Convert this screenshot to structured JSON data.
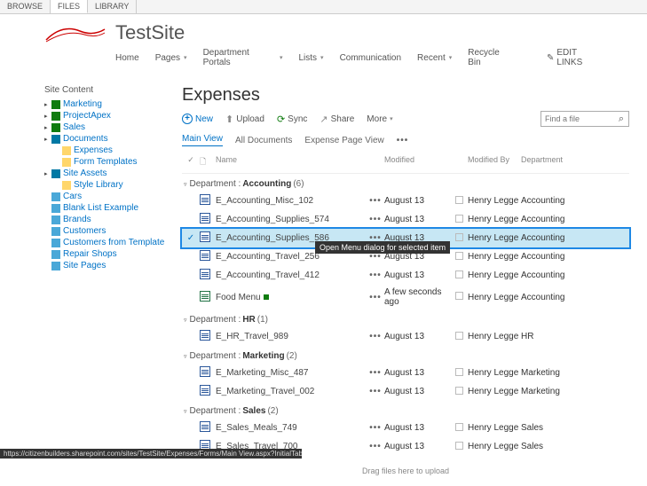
{
  "ribbon": {
    "tabs": [
      "BROWSE",
      "FILES",
      "LIBRARY"
    ],
    "active": 1
  },
  "site": {
    "title": "TestSite"
  },
  "topnav": {
    "items": [
      {
        "label": "Home",
        "dropdown": false
      },
      {
        "label": "Pages",
        "dropdown": true
      },
      {
        "label": "Department Portals",
        "dropdown": true
      },
      {
        "label": "Lists",
        "dropdown": true
      },
      {
        "label": "Communication",
        "dropdown": false
      },
      {
        "label": "Recent",
        "dropdown": true
      },
      {
        "label": "Recycle Bin",
        "dropdown": false
      }
    ],
    "edit_links": "EDIT LINKS"
  },
  "sidebar": {
    "title": "Site Content",
    "items": [
      {
        "label": "Marketing",
        "indent": 0,
        "caret": true,
        "icon": "icon-green"
      },
      {
        "label": "ProjectApex",
        "indent": 0,
        "caret": true,
        "icon": "icon-green"
      },
      {
        "label": "Sales",
        "indent": 0,
        "caret": true,
        "icon": "icon-green"
      },
      {
        "label": "Documents",
        "indent": 0,
        "caret": true,
        "icon": "icon-teal"
      },
      {
        "label": "Expenses",
        "indent": 1,
        "caret": false,
        "icon": "icon-folder"
      },
      {
        "label": "Form Templates",
        "indent": 1,
        "caret": false,
        "icon": "icon-folder"
      },
      {
        "label": "Site Assets",
        "indent": 0,
        "caret": true,
        "icon": "icon-teal"
      },
      {
        "label": "Style Library",
        "indent": 1,
        "caret": false,
        "icon": "icon-folder"
      },
      {
        "label": "Cars",
        "indent": 0,
        "caret": false,
        "icon": "icon-list"
      },
      {
        "label": "Blank List Example",
        "indent": 0,
        "caret": false,
        "icon": "icon-list"
      },
      {
        "label": "Brands",
        "indent": 0,
        "caret": false,
        "icon": "icon-list"
      },
      {
        "label": "Customers",
        "indent": 0,
        "caret": false,
        "icon": "icon-list"
      },
      {
        "label": "Customers from Template",
        "indent": 0,
        "caret": false,
        "icon": "icon-list"
      },
      {
        "label": "Repair Shops",
        "indent": 0,
        "caret": false,
        "icon": "icon-list"
      },
      {
        "label": "Site Pages",
        "indent": 0,
        "caret": false,
        "icon": "icon-list"
      }
    ]
  },
  "page": {
    "title": "Expenses"
  },
  "commands": {
    "new": "New",
    "upload": "Upload",
    "sync": "Sync",
    "share": "Share",
    "more": "More"
  },
  "search": {
    "placeholder": "Find a file"
  },
  "views": {
    "main": "Main View",
    "all": "All Documents",
    "expense": "Expense Page View"
  },
  "columns": {
    "name": "Name",
    "modified": "Modified",
    "modified_by": "Modified By",
    "department": "Department"
  },
  "tooltip": "Open Menu dialog for selected item",
  "groups": [
    {
      "label": "Department",
      "value": "Accounting",
      "count": "(6)",
      "rows": [
        {
          "name": "E_Accounting_Misc_102",
          "modified": "August 13",
          "by": "Henry Legge",
          "dept": "Accounting",
          "type": "word"
        },
        {
          "name": "E_Accounting_Supplies_574",
          "modified": "August 13",
          "by": "Henry Legge",
          "dept": "Accounting",
          "type": "word"
        },
        {
          "name": "E_Accounting_Supplies_586",
          "modified": "August 13",
          "by": "Henry Legge",
          "dept": "Accounting",
          "type": "word",
          "selected": true,
          "tooltip": true
        },
        {
          "name": "E_Accounting_Travel_256",
          "modified": "August 13",
          "by": "Henry Legge",
          "dept": "Accounting",
          "type": "word"
        },
        {
          "name": "E_Accounting_Travel_412",
          "modified": "August 13",
          "by": "Henry Legge",
          "dept": "Accounting",
          "type": "word"
        },
        {
          "name": "Food Menu",
          "modified": "A few seconds ago",
          "by": "Henry Legge",
          "dept": "Accounting",
          "type": "excel",
          "new": true
        }
      ]
    },
    {
      "label": "Department",
      "value": "HR",
      "count": "(1)",
      "rows": [
        {
          "name": "E_HR_Travel_989",
          "modified": "August 13",
          "by": "Henry Legge",
          "dept": "HR",
          "type": "word"
        }
      ]
    },
    {
      "label": "Department",
      "value": "Marketing",
      "count": "(2)",
      "rows": [
        {
          "name": "E_Marketing_Misc_487",
          "modified": "August 13",
          "by": "Henry Legge",
          "dept": "Marketing",
          "type": "word"
        },
        {
          "name": "E_Marketing_Travel_002",
          "modified": "August 13",
          "by": "Henry Legge",
          "dept": "Marketing",
          "type": "word"
        }
      ]
    },
    {
      "label": "Department",
      "value": "Sales",
      "count": "(2)",
      "rows": [
        {
          "name": "E_Sales_Meals_749",
          "modified": "August 13",
          "by": "Henry Legge",
          "dept": "Sales",
          "type": "word"
        },
        {
          "name": "E_Sales_Travel_700",
          "modified": "August 13",
          "by": "Henry Legge",
          "dept": "Sales",
          "type": "word"
        }
      ]
    }
  ],
  "drag_hint": "Drag files here to upload",
  "status_url": "https://citizenbuilders.sharepoint.com/sites/TestSite/Expenses/Forms/Main View.aspx?InitialTabId=Ribbon%2ERead&..."
}
